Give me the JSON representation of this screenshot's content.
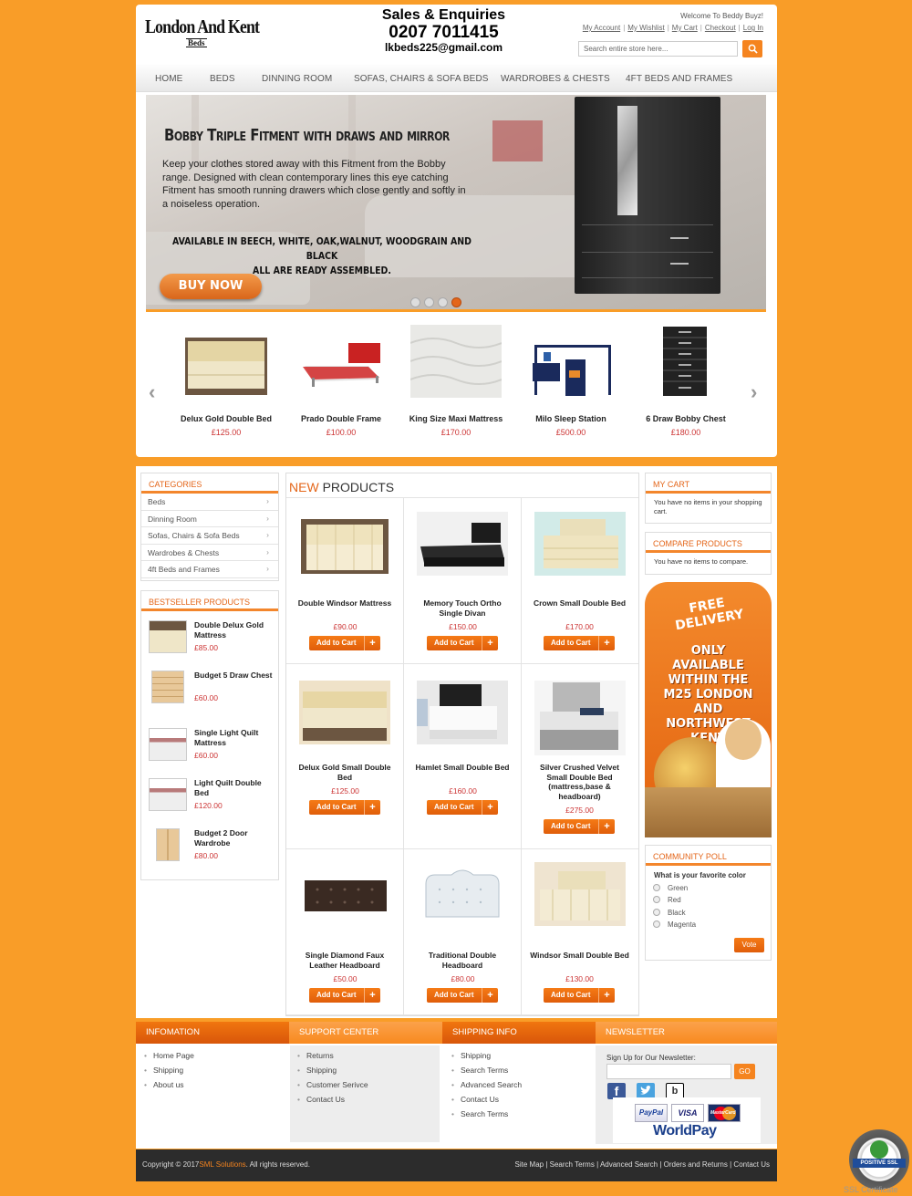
{
  "header": {
    "logo_line1": "London And Kent",
    "logo_line2": "Beds",
    "sales_title": "Sales & Enquiries",
    "phone": "0207 7011415",
    "email": "lkbeds225@gmail.com",
    "welcome": "Welcome To Beddy Buyz!",
    "links": [
      "My Account",
      "My Wishlist",
      "My Cart",
      "Checkout",
      "Log In"
    ],
    "search_placeholder": "Search entire store here..."
  },
  "nav": [
    "HOME",
    "BEDS",
    "DINNING ROOM",
    "SOFAS, CHAIRS & SOFA BEDS",
    "WARDROBES & CHESTS",
    "4FT BEDS AND FRAMES"
  ],
  "banner": {
    "title": "Bobby Triple Fitment with draws and mirror",
    "description": "Keep your clothes stored away with this Fitment from the Bobby range. Designed with clean contemporary lines this eye catching Fitment has smooth running drawers which close gently and softly in a noiseless operation.",
    "availability_line1": "AVAILABLE IN BEECH, WHITE, OAK,WALNUT, WOODGRAIN AND BLACK",
    "availability_line2": "ALL ARE READY ASSEMBLED.",
    "button": "BUY NOW",
    "slide_count": 4,
    "active_slide": 4
  },
  "carousel": [
    {
      "name": "Delux Gold Double Bed",
      "price": "£125.00"
    },
    {
      "name": "Prado Double Frame",
      "price": "£100.00"
    },
    {
      "name": "King Size Maxi Mattress",
      "price": "£170.00"
    },
    {
      "name": "Milo Sleep Station",
      "price": "£500.00"
    },
    {
      "name": "6 Draw Bobby Chest",
      "price": "£180.00"
    }
  ],
  "categories": {
    "title": "CATEGORIES",
    "items": [
      "Beds",
      "Dinning Room",
      "Sofas, Chairs & Sofa Beds",
      "Wardrobes & Chests",
      "4ft Beds and Frames"
    ]
  },
  "bestsellers": {
    "title": "BESTSELLER PRODUCTS",
    "items": [
      {
        "name": "Double Delux Gold Mattress",
        "price": "£85.00"
      },
      {
        "name": "Budget 5 Draw Chest",
        "price": "£60.00"
      },
      {
        "name": "Single Light Quilt Mattress",
        "price": "£60.00"
      },
      {
        "name": "Light Quilt Double Bed",
        "price": "£120.00"
      },
      {
        "name": "Budget 2 Door Wardrobe",
        "price": "£80.00"
      }
    ]
  },
  "new_products": {
    "title_accent": "NEW",
    "title_rest": "PRODUCTS",
    "add_label": "Add to Cart",
    "items": [
      {
        "name": "Double Windsor Mattress",
        "price": "£90.00"
      },
      {
        "name": "Memory Touch Ortho Single Divan",
        "price": "£150.00"
      },
      {
        "name": "Crown Small Double Bed",
        "price": "£170.00"
      },
      {
        "name": "Delux Gold Small Double Bed",
        "price": "£125.00"
      },
      {
        "name": "Hamlet Small Double Bed",
        "price": "£160.00"
      },
      {
        "name": "Silver Crushed Velvet Small Double Bed (mattress,base & headboard)",
        "price": "£275.00"
      },
      {
        "name": "Single Diamond Faux Leather Headboard",
        "price": "£50.00"
      },
      {
        "name": "Traditional Double Headboard",
        "price": "£80.00"
      },
      {
        "name": "Windsor Small Double Bed",
        "price": "£130.00"
      }
    ]
  },
  "cart": {
    "title": "MY CART",
    "text": "You have no items in your shopping cart."
  },
  "compare": {
    "title": "COMPARE PRODUCTS",
    "text": "You have no items to compare."
  },
  "delivery_ad": {
    "line1": "FREE",
    "line2": "DELIVERY",
    "body": "ONLY AVAILABLE WITHIN THE M25 LONDON AND NORTHWEST KENT"
  },
  "poll": {
    "title": "COMMUNITY POLL",
    "question": "What is your favorite color",
    "options": [
      "Green",
      "Red",
      "Black",
      "Magenta"
    ],
    "button": "Vote"
  },
  "footer": {
    "information": {
      "title": "INFOMATION",
      "links": [
        "Home Page",
        "Shipping",
        "About us"
      ]
    },
    "support": {
      "title": "SUPPORT CENTER",
      "links": [
        "Returns",
        "Shipping",
        "Customer Serivce",
        "Contact Us"
      ]
    },
    "shipping": {
      "title": "SHIPPING INFO",
      "links": [
        "Shipping",
        "Search Terms",
        "Advanced Search",
        "Contact Us",
        "Search Terms"
      ]
    },
    "newsletter": {
      "title": "NEWSLETTER",
      "label": "Sign Up for Our Newsletter:",
      "button": "GO"
    },
    "payments": [
      "PayPal",
      "VISA",
      "MasterCard",
      "WorldPay"
    ],
    "copyright_pre": "Copyright © 2017",
    "copyright_brand": "SML Solutions",
    "copyright_post": ". All rights reserved.",
    "bottom_links": [
      "Site Map",
      "Search Terms",
      "Advanced Search",
      "Orders and Returns",
      "Contact Us"
    ],
    "ssl_text": "POSITIVE SSL",
    "ssl_caption": "SSL Certificate"
  },
  "colors": {
    "accent": "#f5841f",
    "background": "#f99d28",
    "price": "#cc3333"
  }
}
